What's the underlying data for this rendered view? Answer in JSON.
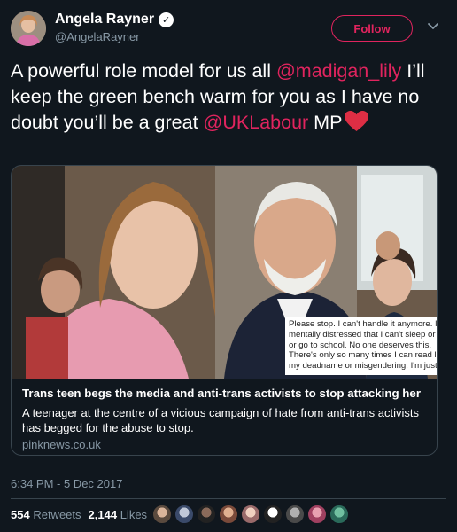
{
  "user": {
    "name": "Angela Rayner",
    "handle": "@AngelaRayner",
    "verified_icon": "✓"
  },
  "header": {
    "follow_label": "Follow"
  },
  "tweet": {
    "text_1": "A powerful role model for us all ",
    "mention_1": "@madigan_lily",
    "text_2": " I’ll keep the green bench warm for you as I have no doubt you’ll be a great ",
    "mention_2": "@UKLabour",
    "text_3": " MP"
  },
  "card": {
    "overlay_lines": [
      "Please stop. I can't handle it anymore. I'",
      "mentally distressed that I can't sleep or e",
      "or go to school. No one deserves this.",
      "There's only so many times I can read lie",
      "my deadname or misgendering. I'm just"
    ],
    "title": "Trans teen begs the media and anti-trans activists to stop attacking her",
    "description": "A teenager at the centre of a vicious campaign of hate from anti-trans activists has begged for the abuse to stop.",
    "domain": "pinknews.co.uk"
  },
  "timestamp": "6:34 PM - 5 Dec 2017",
  "stats": {
    "retweets_count": "554",
    "retweets_label": "Retweets",
    "likes_count": "2,144",
    "likes_label": "Likes"
  },
  "colors": {
    "background": "#10171e",
    "accent": "#e0245e",
    "secondary_text": "#8899a6",
    "border": "#38444d"
  },
  "icons": [
    "verified-badge-icon",
    "chevron-down-icon",
    "heart-emoji-icon"
  ]
}
